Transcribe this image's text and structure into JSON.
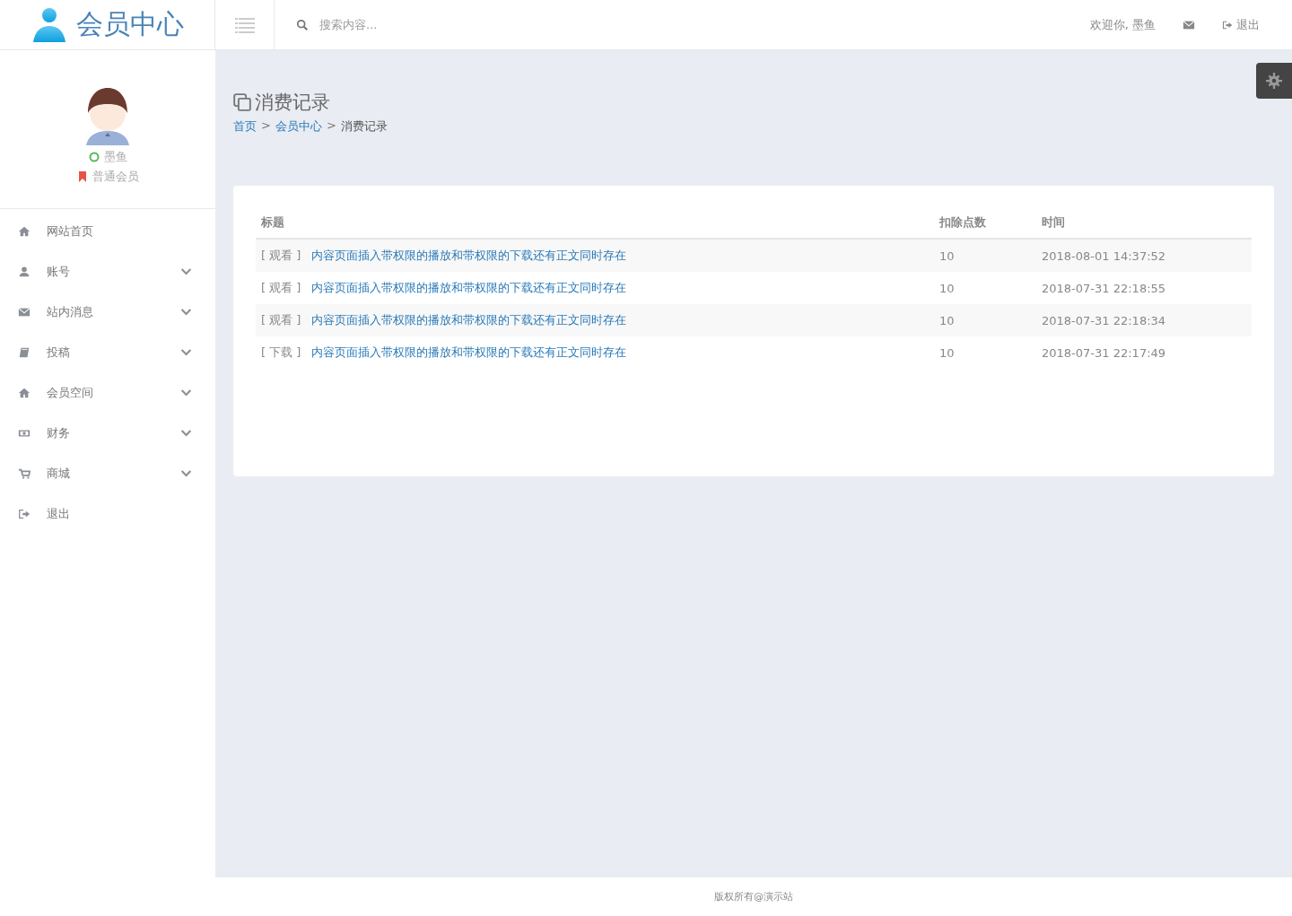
{
  "header": {
    "logo": "会员中心",
    "search": {
      "placeholder": "搜索内容..."
    },
    "welcome": "欢迎你, 墨鱼",
    "logout": "退出"
  },
  "profile": {
    "name": "墨鱼",
    "online": true,
    "level": "普通会员"
  },
  "sidebar": {
    "items": [
      {
        "label": "网站首页",
        "expandable": false
      },
      {
        "label": "账号",
        "expandable": true
      },
      {
        "label": "站内消息",
        "expandable": true
      },
      {
        "label": "投稿",
        "expandable": true
      },
      {
        "label": "会员空间",
        "expandable": true
      },
      {
        "label": "财务",
        "expandable": true
      },
      {
        "label": "商城",
        "expandable": true
      },
      {
        "label": "退出",
        "expandable": false
      }
    ]
  },
  "page": {
    "title": "消费记录",
    "breadcrumb": [
      {
        "label": "首页",
        "link": true
      },
      {
        "label": "会员中心",
        "link": true
      },
      {
        "label": "消费记录",
        "link": false
      }
    ],
    "separator": ">"
  },
  "table": {
    "columns": [
      "标题",
      "扣除点数",
      "时间"
    ],
    "rows": [
      {
        "type": "[ 观看 ]",
        "title": "内容页面插入带权限的播放和带权限的下载还有正文同时存在",
        "points": "10",
        "time": "2018-08-01 14:37:52"
      },
      {
        "type": "[ 观看 ]",
        "title": "内容页面插入带权限的播放和带权限的下载还有正文同时存在",
        "points": "10",
        "time": "2018-07-31 22:18:55"
      },
      {
        "type": "[ 观看 ]",
        "title": "内容页面插入带权限的播放和带权限的下载还有正文同时存在",
        "points": "10",
        "time": "2018-07-31 22:18:34"
      },
      {
        "type": "[ 下载 ]",
        "title": "内容页面插入带权限的播放和带权限的下载还有正文同时存在",
        "points": "10",
        "time": "2018-07-31 22:17:49"
      }
    ]
  },
  "footer": "版权所有@演示站"
}
